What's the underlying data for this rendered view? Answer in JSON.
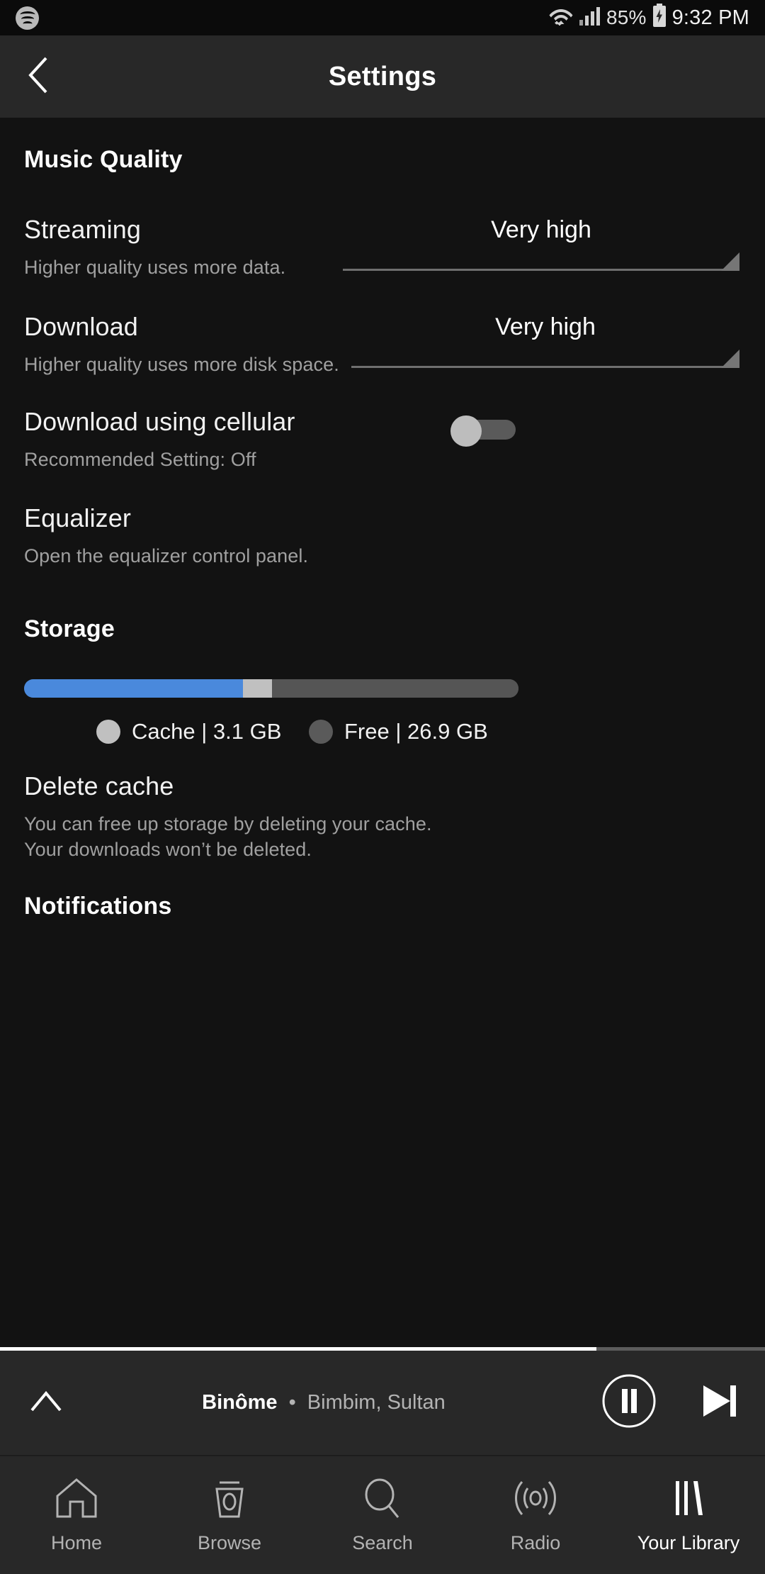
{
  "status_bar": {
    "app_icon": "spotify-icon",
    "wifi_icon": "wifi-icon",
    "signal_icon": "cellular-signal-icon",
    "battery_percent": "85%",
    "battery_icon": "battery-charging-icon",
    "time": "9:32 PM"
  },
  "app_bar": {
    "back_icon": "back-chevron-icon",
    "title": "Settings"
  },
  "sections": {
    "music_quality": {
      "heading": "Music Quality",
      "rows": [
        {
          "title": "Streaming",
          "subtitle": "Higher quality uses more data.",
          "control": "spinner",
          "value": "Very high"
        },
        {
          "title": "Download",
          "subtitle": "Higher quality uses more disk space.",
          "control": "spinner",
          "value": "Very high"
        },
        {
          "title": "Download using cellular",
          "subtitle": "Recommended Setting: Off",
          "control": "toggle",
          "value": "off"
        },
        {
          "title": "Equalizer",
          "subtitle": "Open the equalizer control panel.",
          "control": "none",
          "value": ""
        }
      ]
    },
    "storage": {
      "heading": "Storage",
      "bar": {
        "segments": [
          {
            "name": "used",
            "color": "#4a89dc",
            "percent": 44.3
          },
          {
            "name": "cache",
            "color": "#c0c0c0",
            "percent": 5.9
          },
          {
            "name": "free",
            "color": "#555555",
            "percent": 49.8
          }
        ]
      },
      "legend": [
        {
          "color": "#c0c0c0",
          "label": "Cache | 3.1 GB"
        },
        {
          "color": "#5a5a5a",
          "label": "Free | 26.9 GB"
        }
      ],
      "delete_cache": {
        "title": "Delete cache",
        "subtitle": "You can free up storage by deleting your cache. Your downloads won’t be deleted."
      }
    },
    "notifications": {
      "heading": "Notifications"
    }
  },
  "now_playing": {
    "expand_icon": "chevron-up-icon",
    "track": "Binôme",
    "separator": "•",
    "artist": "Bimbim, Sultan",
    "pause_icon": "pause-icon",
    "next_icon": "next-track-icon",
    "progress_percent": 78
  },
  "bottom_nav": {
    "items": [
      {
        "label": "Home",
        "icon": "home-icon",
        "active": false
      },
      {
        "label": "Browse",
        "icon": "browse-icon",
        "active": false
      },
      {
        "label": "Search",
        "icon": "search-icon",
        "active": false
      },
      {
        "label": "Radio",
        "icon": "radio-icon",
        "active": false
      },
      {
        "label": "Your Library",
        "icon": "library-icon",
        "active": true
      }
    ]
  },
  "colors": {
    "background": "#121212",
    "surface": "#282828",
    "accent_blue": "#4a89dc",
    "text_primary": "#ffffff",
    "text_secondary": "#a0a0a0"
  }
}
